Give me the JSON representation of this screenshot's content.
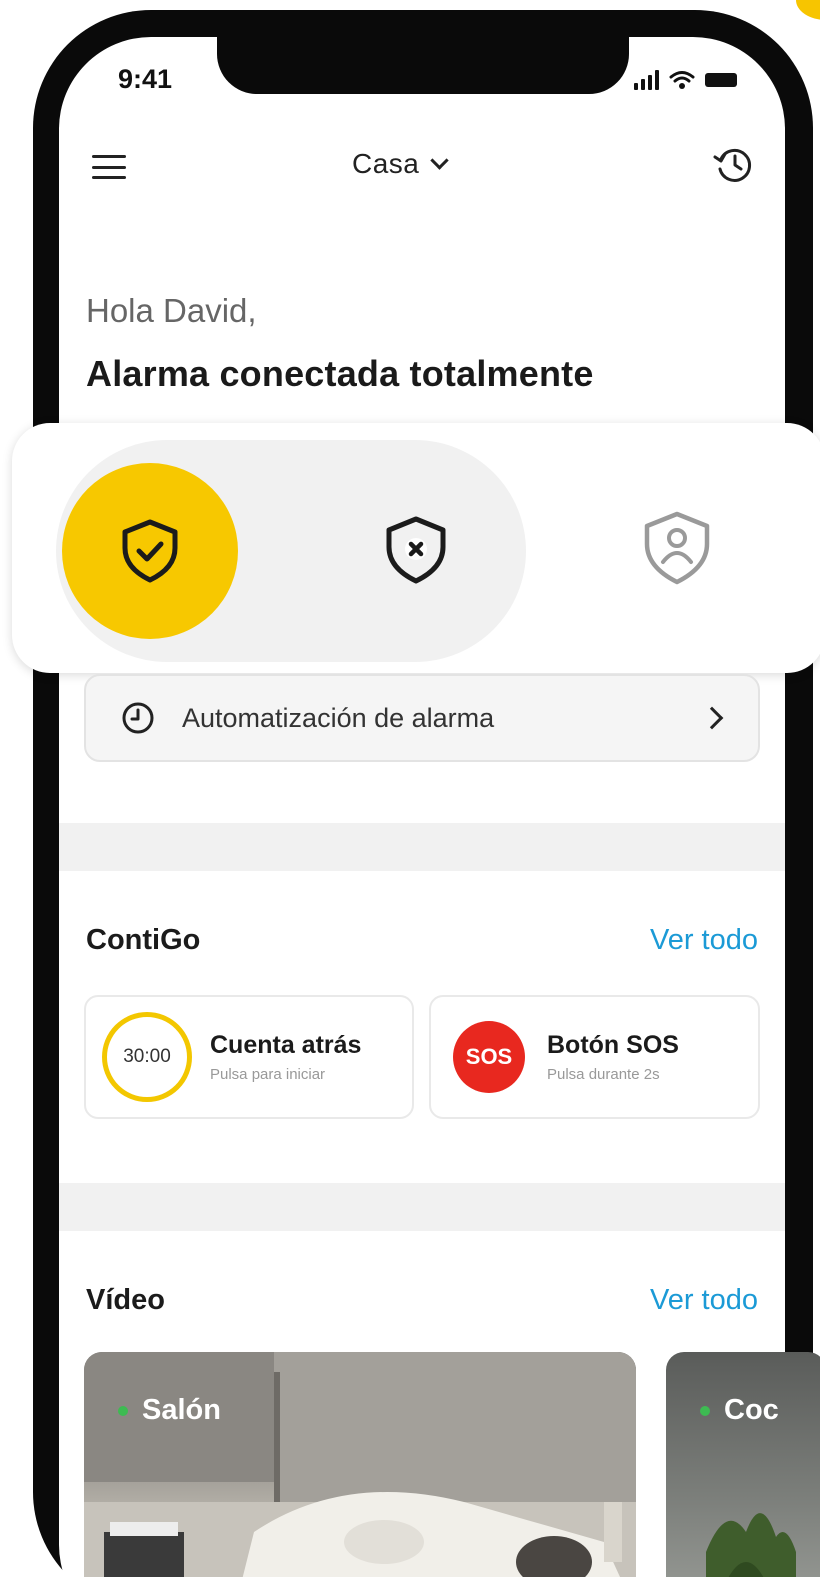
{
  "status_bar": {
    "time": "9:41"
  },
  "header": {
    "location": "Casa",
    "icons": {
      "menu": "hamburger-menu-icon",
      "location_dropdown": "chevron-down-icon",
      "history": "history-clock-icon"
    }
  },
  "greeting": "Hola David,",
  "alarm_status": "Alarma conectada totalmente",
  "alarm_modes": {
    "selected": "armed",
    "items": [
      {
        "id": "armed",
        "icon": "shield-check-icon",
        "color": "#F7C800",
        "selected": true
      },
      {
        "id": "disarmed",
        "icon": "shield-x-icon",
        "selected": false
      },
      {
        "id": "partial",
        "icon": "shield-person-icon",
        "selected": false
      }
    ]
  },
  "automation": {
    "label": "Automatización de alarma"
  },
  "contigo": {
    "title": "ContiGo",
    "see_all": "Ver todo",
    "countdown": {
      "value": "30:00",
      "title": "Cuenta atrás",
      "subtitle": "Pulsa para iniciar",
      "accent": "#F3C700"
    },
    "sos": {
      "badge": "SOS",
      "title": "Botón SOS",
      "subtitle": "Pulsa durante 2s",
      "color": "#E8281F"
    }
  },
  "video": {
    "title": "Vídeo",
    "see_all": "Ver todo",
    "cameras": [
      {
        "name": "Salón",
        "status_color": "#3DBB52"
      },
      {
        "name": "Coc",
        "status_color": "#3DBB52"
      }
    ]
  },
  "colors": {
    "accent": "#F7C800",
    "link": "#1B9AD6",
    "sos": "#E8281F"
  }
}
